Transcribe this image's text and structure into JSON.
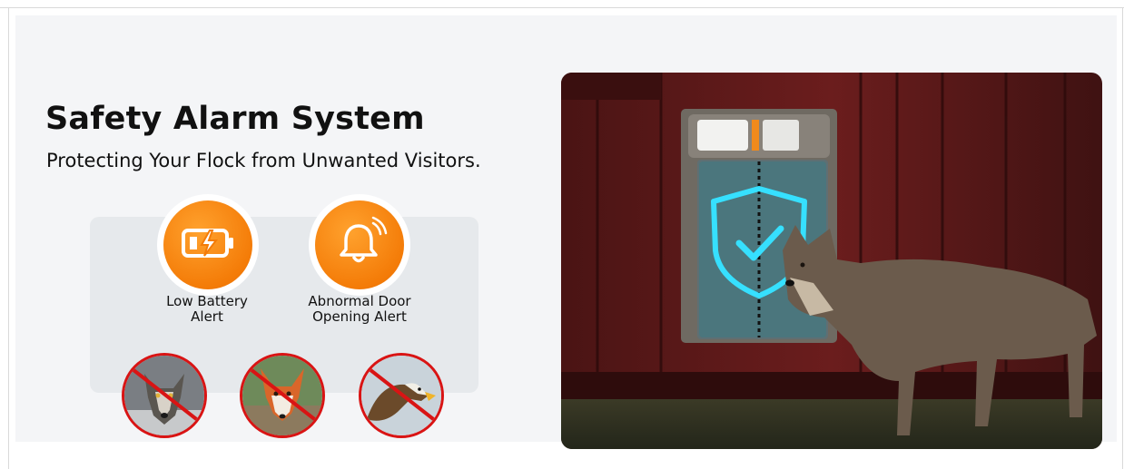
{
  "title": "Safety Alarm System",
  "subtitle": "Protecting Your Flock from Unwanted Visitors.",
  "alerts": [
    {
      "line1": "Low Battery",
      "line2": "Alert",
      "icon": "battery-charging-icon"
    },
    {
      "line1": "Abnormal Door",
      "line2": "Opening Alert",
      "icon": "bell-alarm-icon"
    }
  ],
  "predators": [
    {
      "name": "wolf",
      "icon": "no-wolf-icon"
    },
    {
      "name": "fox",
      "icon": "no-fox-icon"
    },
    {
      "name": "eagle",
      "icon": "no-eagle-icon"
    }
  ],
  "colors": {
    "accent_orange": "#f47c08",
    "prohibit_red": "#d91414",
    "shield_cyan": "#36e0ff",
    "barn_red": "#6b1d1d"
  }
}
